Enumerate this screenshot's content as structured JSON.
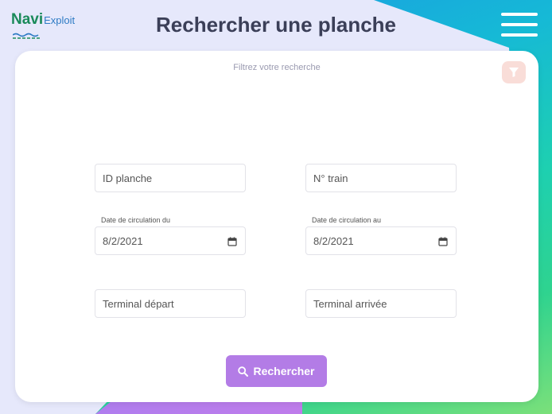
{
  "header": {
    "logo_main": "Navi",
    "logo_sub": "Exploit",
    "title": "Rechercher une planche",
    "menu_icon": "hamburger-menu-icon"
  },
  "filters": {
    "label": "Filtrez votre recherche",
    "filter_icon": "funnel-icon",
    "id_planche": {
      "placeholder": "ID planche",
      "value": ""
    },
    "train": {
      "placeholder": "N° train",
      "value": ""
    },
    "date_du": {
      "label": "Date de circulation du",
      "value": "8/2/2021"
    },
    "date_au": {
      "label": "Date de circulation au",
      "value": "8/2/2021"
    },
    "terminal_depart": {
      "placeholder": "Terminal départ",
      "value": ""
    },
    "terminal_arrivee": {
      "placeholder": "Terminal arrivée",
      "value": ""
    }
  },
  "search_button": {
    "label": "Rechercher",
    "icon": "search-icon"
  },
  "colors": {
    "accent": "#b37ce6",
    "title": "#3b3f58",
    "filter_bg": "#f9ddd8",
    "logo_green": "#1a8a5a",
    "logo_blue": "#2e7bc4"
  }
}
